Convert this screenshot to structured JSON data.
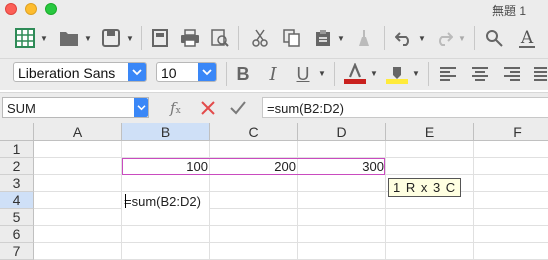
{
  "window": {
    "title": "無題 1"
  },
  "toolbar_font": {
    "font_name": "Liberation Sans",
    "font_size": "10"
  },
  "formula_bar": {
    "name_box": "SUM",
    "formula": "=sum(B2:D2)"
  },
  "columns": [
    "A",
    "B",
    "C",
    "D",
    "E",
    "F"
  ],
  "rows": [
    "1",
    "2",
    "3",
    "4",
    "5",
    "6",
    "7"
  ],
  "cells": {
    "B2": "100",
    "C2": "200",
    "D2": "300"
  },
  "edit_cell": {
    "text": "=sum(B2:D2)"
  },
  "tooltip": {
    "text": "1 R  x 3 C"
  },
  "colors": {
    "reference_border": "#c94bbf",
    "selected_header": "#cfe0f7",
    "accent": "#3a87f7"
  }
}
